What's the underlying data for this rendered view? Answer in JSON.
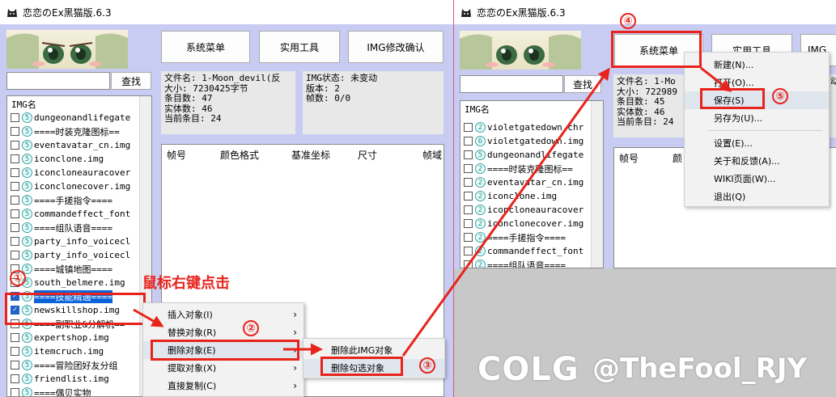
{
  "left_window": {
    "title": "恋恋のEx黑猫版.6.3",
    "buttons": {
      "system_menu": "系统菜单",
      "tools": "实用工具",
      "img_confirm": "IMG修改确认"
    },
    "search": {
      "button": "查找",
      "value": ""
    },
    "file_info": [
      "文件名: 1-Moon_devil(反",
      "大小: 7230425字节",
      "条目数: 47",
      "实体数: 46",
      "当前条目: 24"
    ],
    "img_info": [
      "IMG状态: 未变动",
      "版本: 2",
      "帧数: 0/0"
    ],
    "table_headers": [
      "帧号",
      "颜色格式",
      "基准坐标",
      "尺寸",
      "帧域"
    ],
    "list_header": "IMG名",
    "list_items": [
      {
        "icon": "5",
        "label": "dungeonandlifegate",
        "checked": false,
        "selected": false
      },
      {
        "icon": "5",
        "label": "====时装克隆图标==",
        "checked": false,
        "selected": false
      },
      {
        "icon": "5",
        "label": "eventavatar_cn.img",
        "checked": false,
        "selected": false
      },
      {
        "icon": "5",
        "label": "iconclone.img",
        "checked": false,
        "selected": false
      },
      {
        "icon": "5",
        "label": "iconcloneauracover",
        "checked": false,
        "selected": false
      },
      {
        "icon": "5",
        "label": "iconclonecover.img",
        "checked": false,
        "selected": false
      },
      {
        "icon": "5",
        "label": "====手搓指令====",
        "checked": false,
        "selected": false
      },
      {
        "icon": "5",
        "label": "commandeffect_font",
        "checked": false,
        "selected": false
      },
      {
        "icon": "5",
        "label": "====组队语音====",
        "checked": false,
        "selected": false
      },
      {
        "icon": "5",
        "label": "party_info_voicecl",
        "checked": false,
        "selected": false
      },
      {
        "icon": "5",
        "label": "party_info_voicecl",
        "checked": false,
        "selected": false
      },
      {
        "icon": "5",
        "label": "====城镇地图====",
        "checked": false,
        "selected": false
      },
      {
        "icon": "5",
        "label": "south_belmere.img",
        "checked": false,
        "selected": false
      },
      {
        "icon": "5",
        "label": "====技能精通====",
        "checked": true,
        "selected": true
      },
      {
        "icon": "5",
        "label": "newskillshop.img",
        "checked": true,
        "selected": false
      },
      {
        "icon": "5",
        "label": "====副职业&分解机==",
        "checked": false,
        "selected": false
      },
      {
        "icon": "5",
        "label": "expertshop.img",
        "checked": false,
        "selected": false
      },
      {
        "icon": "5",
        "label": "itemcruch.img",
        "checked": false,
        "selected": false
      },
      {
        "icon": "5",
        "label": "====冒险团好友分组",
        "checked": false,
        "selected": false
      },
      {
        "icon": "5",
        "label": "friendlist.img",
        "checked": false,
        "selected": false
      },
      {
        "icon": "5",
        "label": "====偶贝实物",
        "checked": false,
        "selected": false
      }
    ],
    "context_menu": [
      "插入对象(I)",
      "替换对象(R)",
      "删除对象(E)",
      "提取对象(X)",
      "直接复制(C)"
    ],
    "submenu": [
      "删除此IMG对象",
      "删除勾选对象"
    ],
    "annotation": "鼠标右键点击"
  },
  "right_window": {
    "title": "恋恋のEx黑猫版.6.3",
    "buttons": {
      "system_menu": "系统菜单",
      "tools": "实用工具",
      "img_confirm": "IMG"
    },
    "search": {
      "button": "查找"
    },
    "file_info": [
      "文件名: 1-Mo",
      "大小: 722989",
      "条目数: 45",
      "实体数: 46",
      "当前条目: 24"
    ],
    "img_info_fragment": "动",
    "table_headers": [
      "帧号",
      "颜"
    ],
    "list_header": "IMG名",
    "list_items": [
      {
        "icon": "2",
        "label": "violetgatedown.chr"
      },
      {
        "icon": "6",
        "label": "violetgatedown.img"
      },
      {
        "icon": "5",
        "label": "dungeonandlifegate"
      },
      {
        "icon": "2",
        "label": "====时装克隆图标=="
      },
      {
        "icon": "2",
        "label": "eventavatar_cn.img"
      },
      {
        "icon": "2",
        "label": "iconclone.img"
      },
      {
        "icon": "2",
        "label": "iconcloneauracover"
      },
      {
        "icon": "2",
        "label": "iconclonecover.img"
      },
      {
        "icon": "2",
        "label": "====手搓指令===="
      },
      {
        "icon": "2",
        "label": "commandeffect_font"
      },
      {
        "icon": "2",
        "label": "====组队语音===="
      }
    ],
    "system_menu_items": [
      "新建(N)...",
      "打开(O)...",
      "保存(S)",
      "另存为(U)...",
      "设置(E)...",
      "关于和反馈(A)...",
      "WIKI页面(W)...",
      "退出(Q)"
    ]
  },
  "steps": [
    "①",
    "②",
    "③",
    "④",
    "⑤"
  ],
  "watermark": {
    "logo": "COLG",
    "handle": "@TheFool_RJY"
  },
  "colors": {
    "window_bg": "#c9ccf2",
    "annotation_red": "#e8231c",
    "selection_blue": "#0a64d8"
  }
}
